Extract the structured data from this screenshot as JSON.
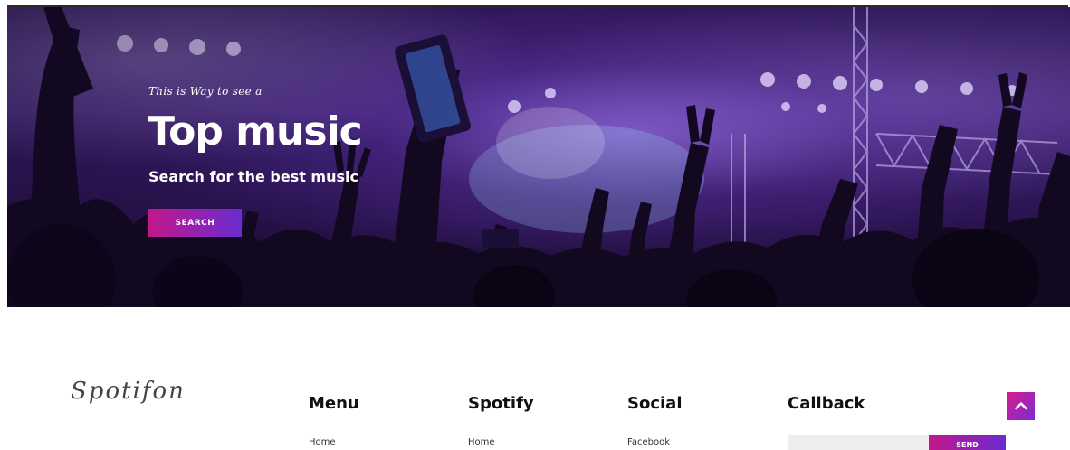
{
  "hero": {
    "tagline": "This is Way to see a",
    "title": "Top music",
    "subtitle": "Search for the best music",
    "search_button": "SEARCH"
  },
  "footer": {
    "logo": "Spotifon",
    "columns": [
      {
        "heading": "Menu",
        "first_link": "Home"
      },
      {
        "heading": "Spotify",
        "first_link": "Home"
      },
      {
        "heading": "Social",
        "first_link": "Facebook"
      }
    ],
    "callback": {
      "heading": "Callback",
      "input_value": "",
      "send_label": "SEND"
    }
  },
  "icons": {
    "scroll_top": "chevron-up-icon"
  },
  "colors": {
    "accent_start": "#c2188a",
    "accent_end": "#6a2bd1",
    "hero_base": "#3d1f73"
  }
}
